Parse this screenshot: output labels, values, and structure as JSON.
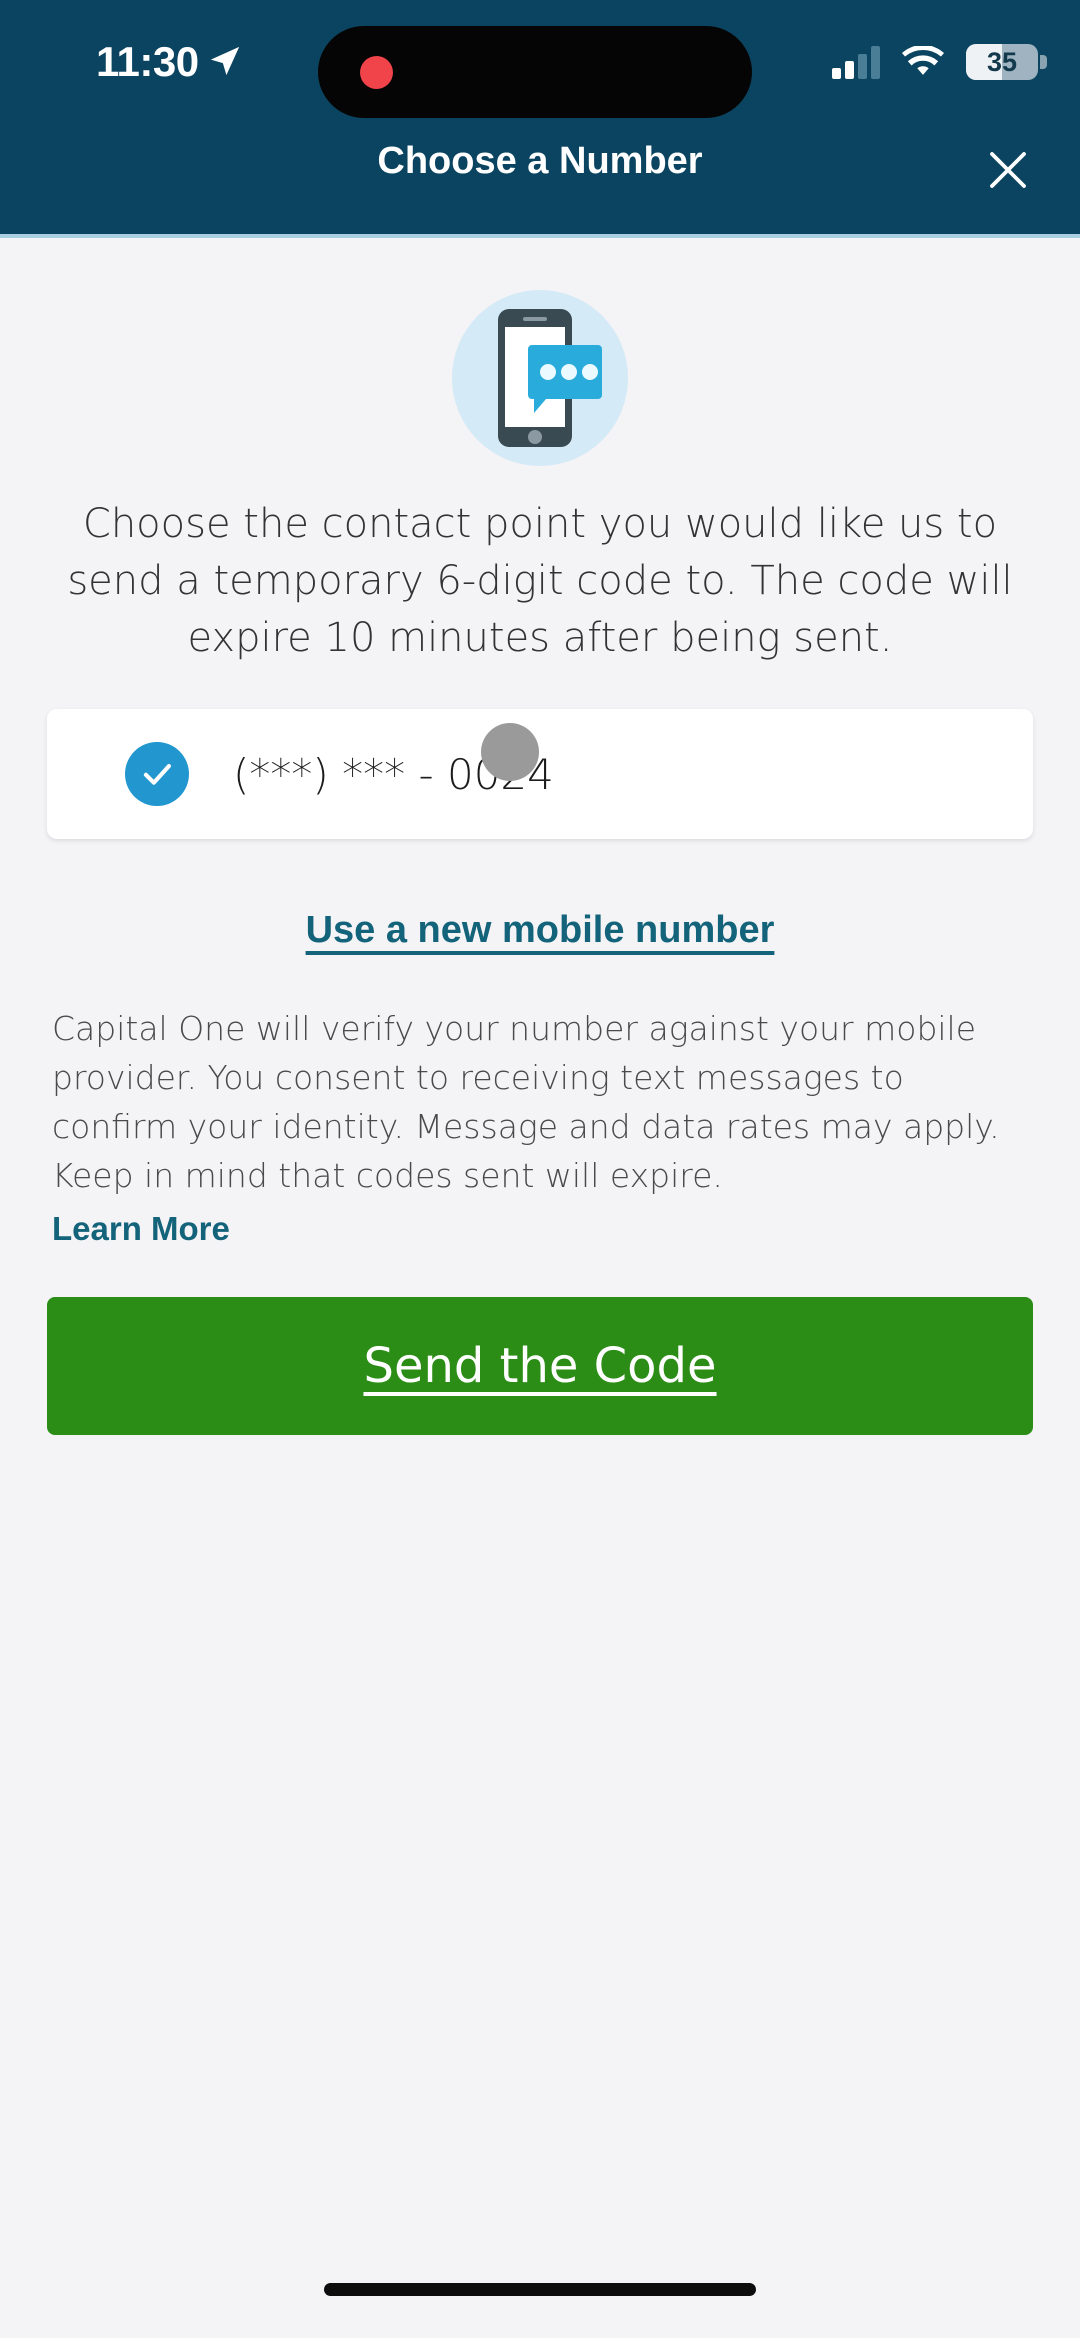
{
  "status_bar": {
    "time": "11:30",
    "location_icon": "location-arrow-icon",
    "recording_indicator": "recording-dot",
    "signal_icon": "cellular-signal-icon",
    "signal_bars_filled": 2,
    "signal_bars_total": 4,
    "wifi_icon": "wifi-icon",
    "battery_percent": "35",
    "battery_level": 35
  },
  "header": {
    "title": "Choose a Number",
    "close_icon": "close-icon",
    "background_color": "#0b4460",
    "divider_color": "#a8cfe2"
  },
  "hero": {
    "icon": "phone-sms-message-icon",
    "circle_color": "#d4eaf7",
    "phone_body_color": "#3a4a52",
    "bubble_color": "#29abdb"
  },
  "main": {
    "lede": "Choose the contact point you would like us to send a temporary 6-digit code to. The code will expire 10 minutes after being sent.",
    "option": {
      "label": "(***) *** - 0024",
      "selected": true,
      "check_icon": "check-circle-icon",
      "check_color": "#2196cf"
    },
    "new_number_link": "Use a new mobile number",
    "disclaimer": "Capital One will verify your number against your mobile provider. You consent to receiving text messages to confirm your identity. Message and data rates may apply. Keep in mind that codes sent will expire.",
    "learn_more_label": "Learn More",
    "link_color": "#13637a",
    "cta_label": "Send the Code",
    "cta_color": "#2b8c16"
  },
  "overlay": {
    "touch_indicator": "touch-point-indicator",
    "touch_color": "#9a9a9a"
  },
  "system": {
    "home_indicator": "home-indicator",
    "background_color": "#f4f3f6"
  }
}
